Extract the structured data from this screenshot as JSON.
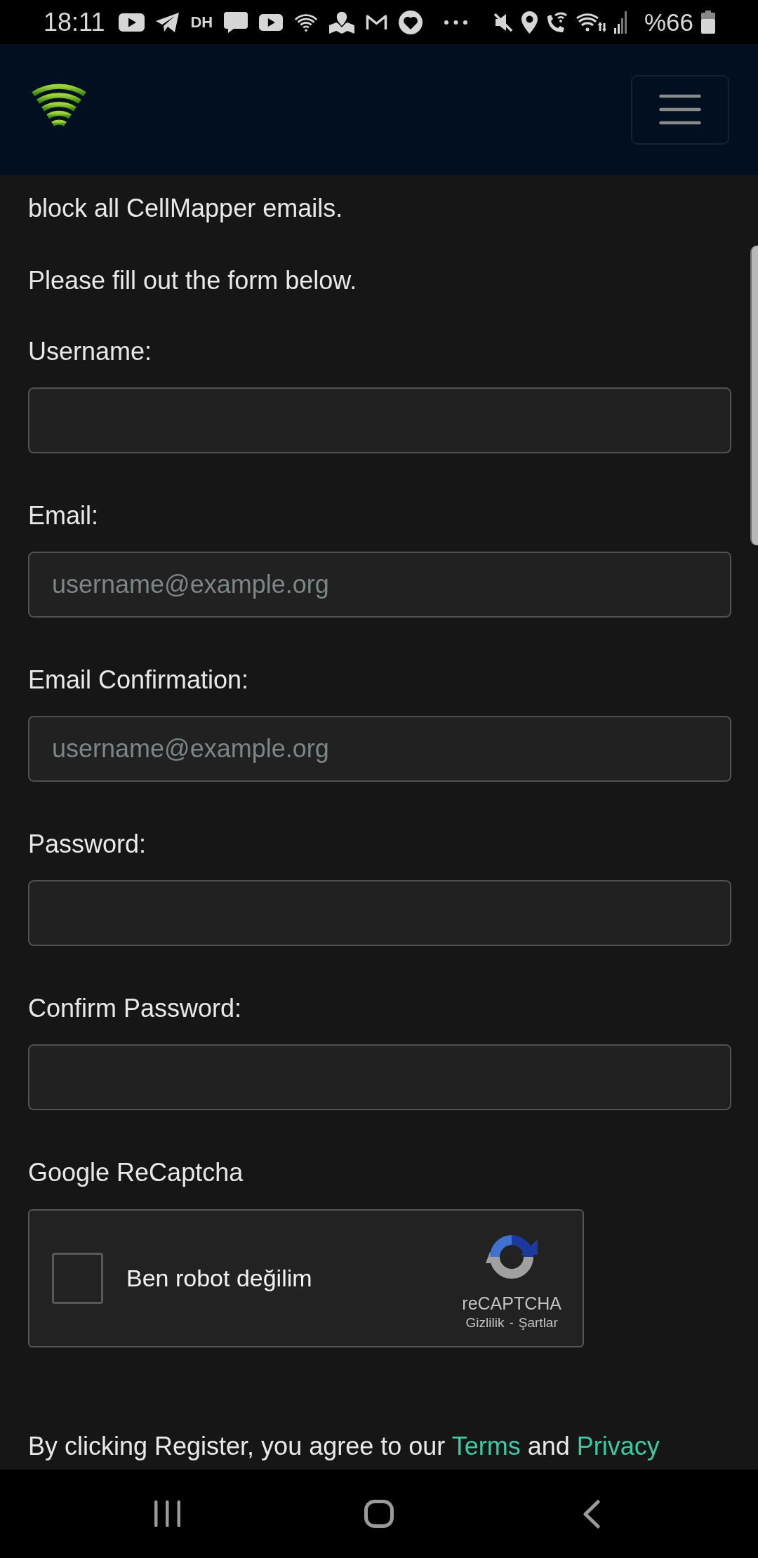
{
  "status_bar": {
    "time": "18:11",
    "notification_label": "DH",
    "battery": "%66"
  },
  "intro": [
    "block all CellMapper emails.",
    "Please fill out the form below."
  ],
  "fields": [
    {
      "label": "Username:"
    },
    {
      "label": "Email:",
      "placeholder": "username@example.org"
    },
    {
      "label": "Email Confirmation:",
      "placeholder": "username@example.org"
    },
    {
      "label": "Password:"
    },
    {
      "label": "Confirm Password:"
    }
  ],
  "recaptcha": {
    "title": "Google ReCaptcha",
    "checkbox_label": "Ben robot değilim",
    "checked": false,
    "brand": "reCAPTCHA",
    "links": [
      "Gizlilik",
      "Şartlar"
    ],
    "separator": "-"
  },
  "agreement": [
    {
      "kind": "text",
      "text": "By clicking Register, you agree to our"
    },
    {
      "kind": "link",
      "text": "Terms"
    },
    {
      "kind": "text",
      "text": "and"
    },
    {
      "kind": "link",
      "text": "Privacy"
    }
  ]
}
